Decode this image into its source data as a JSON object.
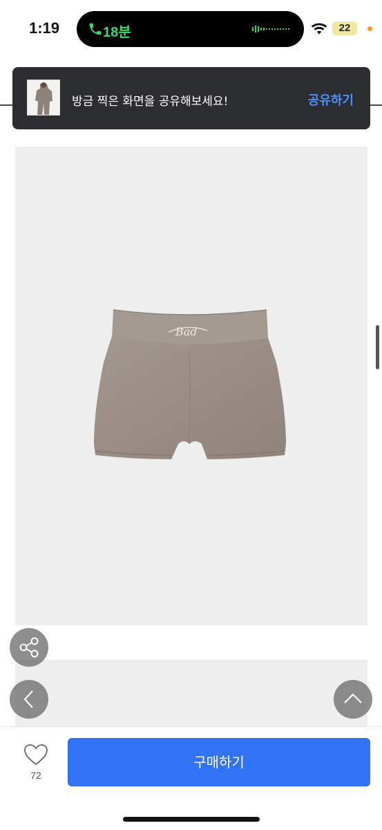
{
  "status_bar": {
    "time": "1:19",
    "call_duration": "18분",
    "battery_level": "22",
    "call_color": "#3bd96b",
    "battery_color": "#f1e7a0"
  },
  "share_toast": {
    "message": "방금 찍은 화면을 공유해보세요!",
    "action_label": "공유하기",
    "action_color": "#4f8ff7"
  },
  "product": {
    "logo_text": "Bad",
    "image_background": "#eeeeee",
    "garment_color": "#9d9189"
  },
  "floating_buttons": {
    "share_icon": "share-icon",
    "back_icon": "chevron-left-icon",
    "top_icon": "chevron-up-icon"
  },
  "bottom_bar": {
    "like_count": "72",
    "buy_label": "구매하기",
    "buy_color": "#3272f5"
  }
}
